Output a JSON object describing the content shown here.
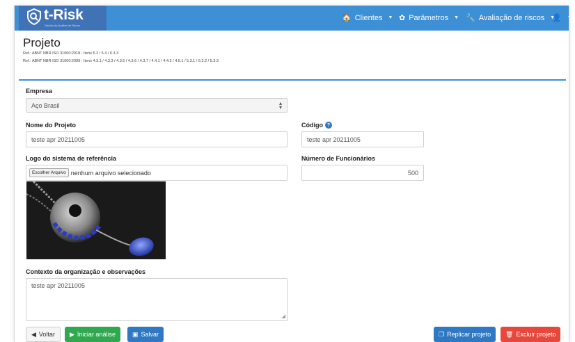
{
  "brand": {
    "name": "t-Risk",
    "tagline": "Gestão da Análise de Riscos"
  },
  "nav": [
    {
      "icon": "home-icon",
      "glyph": "🏠",
      "label": "Clientes"
    },
    {
      "icon": "gear-icon",
      "glyph": "✿",
      "label": "Parâmetros"
    },
    {
      "icon": "wrench-icon",
      "glyph": "🔧",
      "label": "Avaliação de riscos"
    },
    {
      "icon": "user-icon",
      "glyph": "👤",
      "label": ""
    }
  ],
  "page": {
    "title": "Projeto",
    "ref1": "Ref.: ABNT NBR ISO 31000:2018 - Itens 5.2 / 5.4 / 6.3.3",
    "ref2": "Ref.: ABNT NBR ISO 31000:2009 - Itens 4.3.1 / 4.3.3 / 4.3.5 / 4.3.6 / 4.3.7 / 4.4.1 / 4.4.2 / 4.5.1 / 5.3.1 / 5.3.2 / 5.3.3"
  },
  "form": {
    "empresa_label": "Empresa",
    "empresa_value": "Aço Brasil",
    "nome_label": "Nome do Projeto",
    "nome_value": "teste apr 20211005",
    "codigo_label": "Código",
    "codigo_value": "teste apr 20211005",
    "logo_label": "Logo do sistema de referência",
    "file_button": "Escolher Arquivo",
    "file_status": "nenhum arquivo selecionado",
    "funcionarios_label": "Número de Funcionários",
    "funcionarios_value": "500",
    "contexto_label": "Contexto da organização e observações",
    "contexto_value": "teste apr 20211005"
  },
  "buttons": {
    "voltar": "Voltar",
    "iniciar": "Iniciar análise",
    "salvar": "Salvar",
    "replicar": "Replicar projeto",
    "excluir": "Excluir projeto"
  },
  "colors": {
    "navbar": "#3d8fd6",
    "brand_bg": "#3f73b6",
    "green": "#2fa84f",
    "blue": "#2f78c4",
    "red": "#e8473b"
  }
}
